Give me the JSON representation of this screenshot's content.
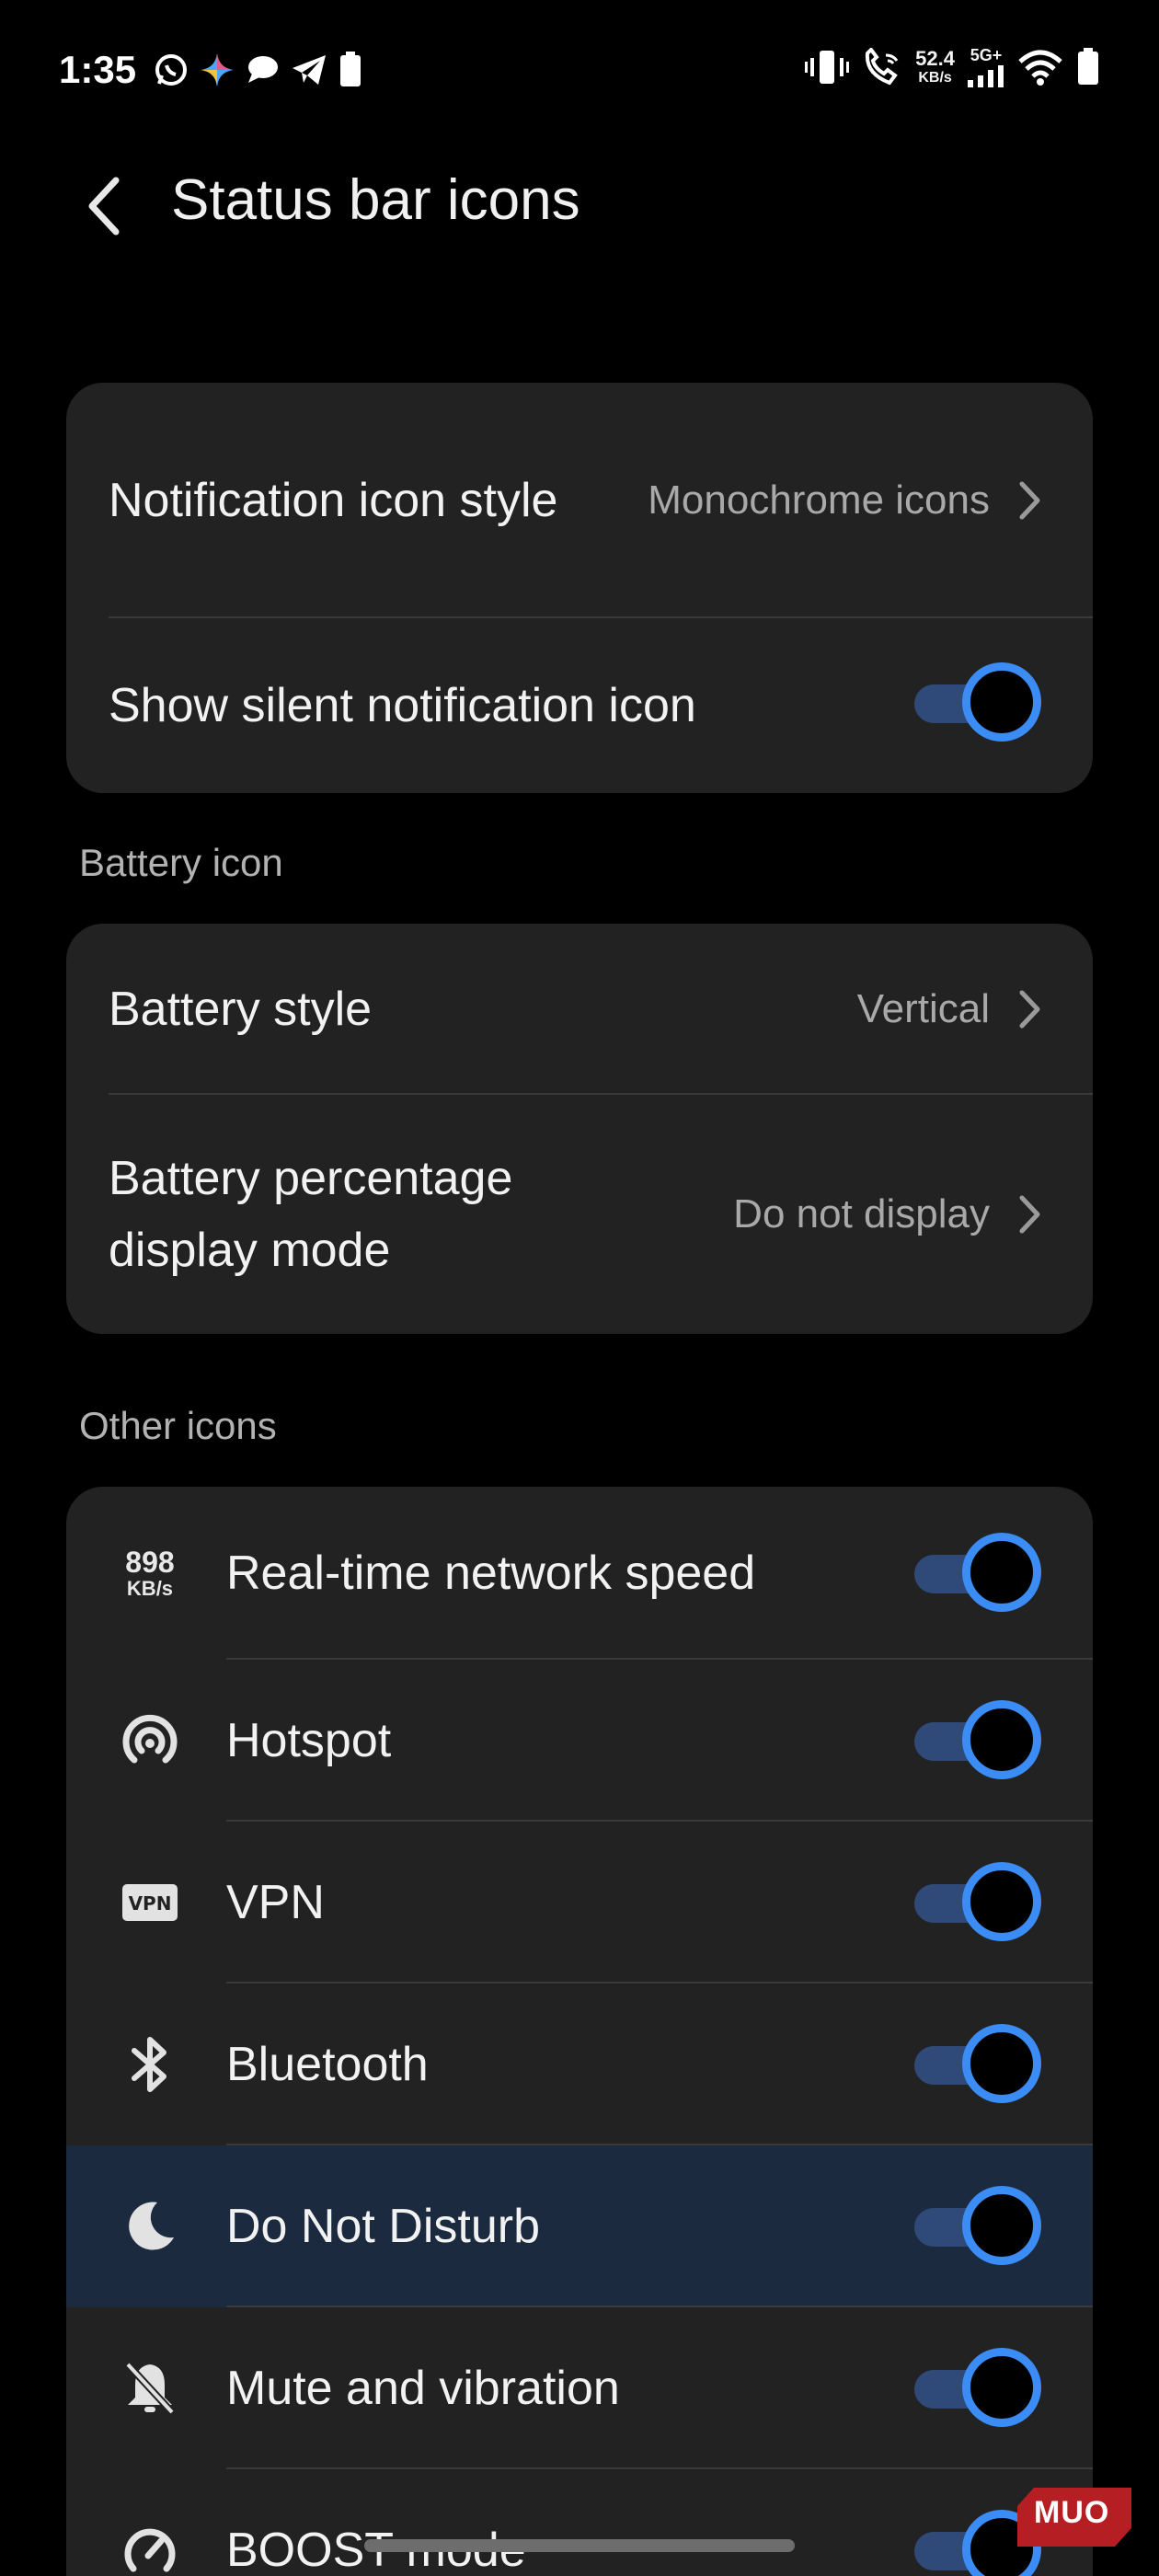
{
  "status_bar": {
    "time": "1:35",
    "network_speed_value": "52.4",
    "network_speed_unit": "KB/s",
    "network_type": "5G+",
    "left_icons": [
      "whatsapp-icon",
      "gemini-sparkle-icon",
      "chat-bubble-icon",
      "telegram-icon",
      "battery-icon"
    ],
    "right_icons": [
      "vibrate-icon",
      "wifi-calling-icon",
      "signal-bars-icon",
      "wifi-icon",
      "battery-icon"
    ]
  },
  "header": {
    "title": "Status bar icons",
    "back_icon": "chevron-left-icon"
  },
  "notifications_card": {
    "items": [
      {
        "label": "Notification icon style",
        "value": "Monochrome icons"
      },
      {
        "label": "Show silent notification icon",
        "toggle_on": true
      }
    ]
  },
  "battery_section": {
    "header": "Battery icon",
    "items": [
      {
        "label": "Battery style",
        "value": "Vertical"
      },
      {
        "label": "Battery percentage display mode",
        "value": "Do not display"
      }
    ]
  },
  "other_section": {
    "header": "Other icons",
    "speed_icon_value": "898",
    "speed_icon_unit": "KB/s",
    "items": [
      {
        "label": "Real-time network speed",
        "icon": "network-speed-icon",
        "toggle_on": true
      },
      {
        "label": "Hotspot",
        "icon": "hotspot-icon",
        "toggle_on": true
      },
      {
        "label": "VPN",
        "icon": "vpn-icon",
        "toggle_on": true
      },
      {
        "label": "Bluetooth",
        "icon": "bluetooth-icon",
        "toggle_on": true
      },
      {
        "label": "Do Not Disturb",
        "icon": "moon-icon",
        "toggle_on": true
      },
      {
        "label": "Mute and vibration",
        "icon": "bell-off-icon",
        "toggle_on": true
      },
      {
        "label": "BOOST mode",
        "icon": "gauge-icon",
        "toggle_on": true
      }
    ]
  },
  "watermark": {
    "text": "MUO"
  },
  "colors": {
    "background": "#000000",
    "card": "#222222",
    "accent": "#3b8cf4",
    "track": "#2f4a78",
    "highlight_row": "#1c2a3f",
    "secondary_text": "#a9a9a9"
  }
}
